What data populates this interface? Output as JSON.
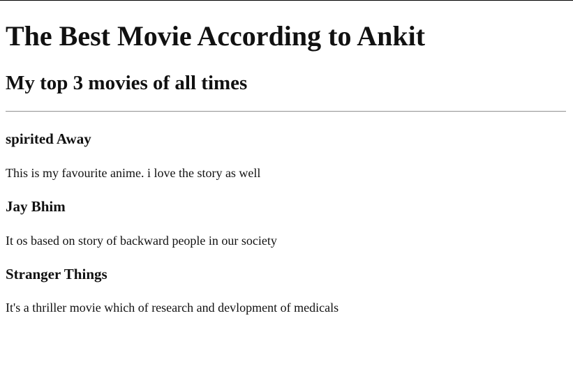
{
  "page": {
    "title": "The Best Movie According to Ankit",
    "subtitle": "My top 3 movies of all times"
  },
  "movies": [
    {
      "title": "spirited Away",
      "description": "This is my favourite anime. i love the story as well"
    },
    {
      "title": "Jay Bhim",
      "description": "It os based on story of backward people in our society"
    },
    {
      "title": "Stranger Things",
      "description": "It's a thriller movie which of research and devlopment of medicals"
    }
  ]
}
